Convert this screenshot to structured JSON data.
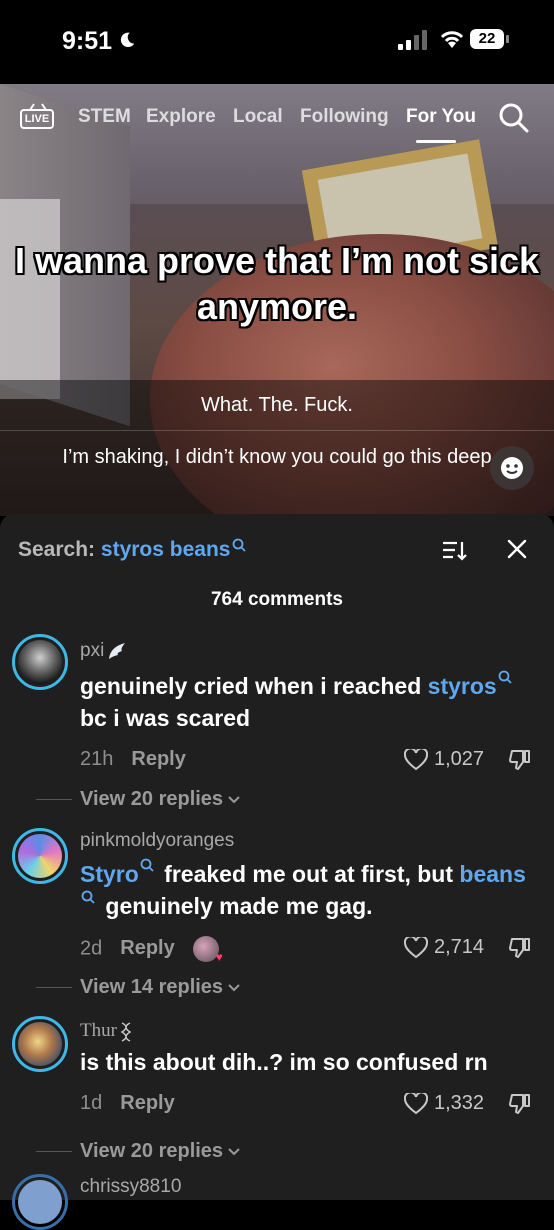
{
  "status_bar": {
    "time": "9:51",
    "battery": "22"
  },
  "nav": {
    "live_label": "LIVE",
    "tabs": [
      "STEM",
      "Explore",
      "Local",
      "Following",
      "For You"
    ],
    "active_tab": "For You"
  },
  "video": {
    "caption": "I wanna prove that I’m not sick anymore.",
    "overlay_comments": [
      "What. The. Fuck.",
      "I’m shaking, I didn’t know you could go this deep"
    ]
  },
  "comments_panel": {
    "search_prefix": "Search:",
    "search_query": "styros beans",
    "count_label": "764 comments",
    "comments": [
      {
        "username": "pxi",
        "text_parts": [
          {
            "t": "genuinely cried when i reached "
          },
          {
            "t": "styros",
            "tag": true
          },
          {
            "t": " bc i was scared"
          }
        ],
        "time": "21h",
        "reply_label": "Reply",
        "likes": "1,027",
        "view_replies": "View 20 replies"
      },
      {
        "username": "pinkmoldyoranges",
        "text_parts": [
          {
            "t": "Styro",
            "tag": true
          },
          {
            "t": " freaked me out at first, but "
          },
          {
            "t": "beans",
            "tag": true
          },
          {
            "t": " genuinely made me gag."
          }
        ],
        "time": "2d",
        "reply_label": "Reply",
        "likes": "2,714",
        "view_replies": "View 14 replies"
      },
      {
        "username": "Thur",
        "text_parts": [
          {
            "t": "is this about dih..? im so confused rn"
          }
        ],
        "time": "1d",
        "reply_label": "Reply",
        "likes": "1,332",
        "view_replies": "View 20 replies"
      },
      {
        "username": "chrissy8810"
      }
    ]
  },
  "colors": {
    "tag_blue": "#5fa8f0",
    "panel_bg": "#1f1f1f",
    "avatar_ring": "#3fb8e8"
  }
}
